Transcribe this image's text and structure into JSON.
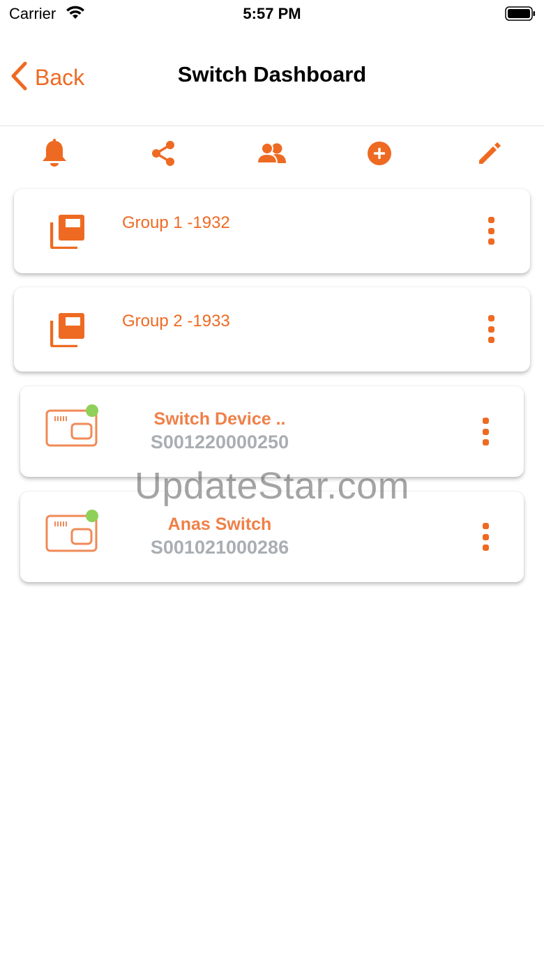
{
  "status_bar": {
    "carrier": "Carrier",
    "time": "5:57 PM"
  },
  "nav": {
    "back_label": "Back",
    "title": "Switch Dashboard"
  },
  "toolbar": {
    "icons": [
      "bell-icon",
      "share-icon",
      "users-icon",
      "add-circle-icon",
      "pencil-icon"
    ]
  },
  "groups": [
    {
      "label": "Group 1  -1932"
    },
    {
      "label": "Group 2  -1933"
    }
  ],
  "devices": [
    {
      "name": "Switch Device  ..",
      "serial": "S001220000250",
      "status": "online"
    },
    {
      "name": "Anas Switch",
      "serial": "S001021000286",
      "status": "online"
    }
  ],
  "watermark": "UpdateStar.com",
  "colors": {
    "accent": "#ee6a22",
    "device_text": "#ef8048",
    "serial_text": "#a9aeb2",
    "online": "#8fd05a"
  }
}
